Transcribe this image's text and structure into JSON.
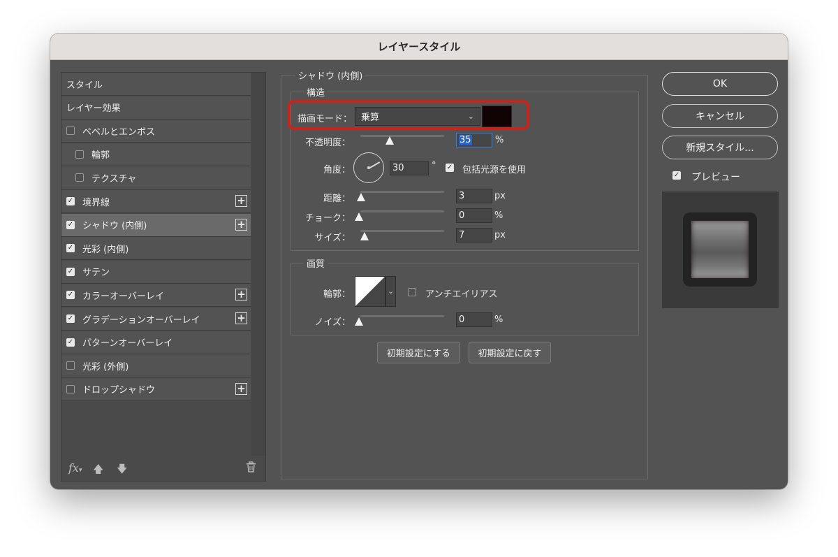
{
  "window": {
    "title": "レイヤースタイル"
  },
  "style_list": {
    "items": [
      {
        "label": "スタイル",
        "checkbox": null,
        "indent": false,
        "plus": false,
        "selected": false
      },
      {
        "label": "レイヤー効果",
        "checkbox": null,
        "indent": false,
        "plus": false,
        "selected": false
      },
      {
        "label": "ベベルとエンボス",
        "checkbox": false,
        "indent": false,
        "plus": false,
        "selected": false
      },
      {
        "label": "輪郭",
        "checkbox": false,
        "indent": true,
        "plus": false,
        "selected": false
      },
      {
        "label": "テクスチャ",
        "checkbox": false,
        "indent": true,
        "plus": false,
        "selected": false
      },
      {
        "label": "境界線",
        "checkbox": true,
        "indent": false,
        "plus": true,
        "selected": false
      },
      {
        "label": "シャドウ (内側)",
        "checkbox": true,
        "indent": false,
        "plus": true,
        "selected": true
      },
      {
        "label": "光彩 (内側)",
        "checkbox": true,
        "indent": false,
        "plus": false,
        "selected": false
      },
      {
        "label": "サテン",
        "checkbox": true,
        "indent": false,
        "plus": false,
        "selected": false
      },
      {
        "label": "カラーオーバーレイ",
        "checkbox": true,
        "indent": false,
        "plus": true,
        "selected": false
      },
      {
        "label": "グラデーションオーバーレイ",
        "checkbox": true,
        "indent": false,
        "plus": true,
        "selected": false
      },
      {
        "label": "パターンオーバーレイ",
        "checkbox": true,
        "indent": false,
        "plus": false,
        "selected": false
      },
      {
        "label": "光彩 (外側)",
        "checkbox": false,
        "indent": false,
        "plus": false,
        "selected": false
      },
      {
        "label": "ドロップシャドウ",
        "checkbox": false,
        "indent": false,
        "plus": true,
        "selected": false
      }
    ],
    "footer": {
      "fx_label": "fx"
    }
  },
  "panel": {
    "title": "シャドウ (内側)",
    "structure": {
      "title": "構造",
      "blend_mode_label": "描画モード：",
      "blend_mode_value": "乗算",
      "shadow_color": "#110303",
      "opacity_label": "不透明度：",
      "opacity_value": "35",
      "opacity_fraction": 0.35,
      "opacity_unit": "%",
      "angle_label": "角度：",
      "angle_value": "30",
      "angle_unit": "°",
      "global_light_label": "包括光源を使用",
      "global_light_checked": true,
      "distance_label": "距離：",
      "distance_value": "3",
      "distance_unit": "px",
      "choke_label": "チョーク：",
      "choke_value": "0",
      "choke_unit": "%",
      "size_label": "サイズ：",
      "size_value": "7",
      "size_unit": "px"
    },
    "quality": {
      "title": "画質",
      "contour_label": "輪郭：",
      "antialias_label": "アンチエイリアス",
      "antialias_checked": false,
      "noise_label": "ノイズ：",
      "noise_value": "0",
      "noise_unit": "%"
    },
    "make_default_label": "初期設定にする",
    "reset_default_label": "初期設定に戻す"
  },
  "actions": {
    "ok_label": "OK",
    "cancel_label": "キャンセル",
    "new_style_label": "新規スタイル...",
    "preview_label": "プレビュー",
    "preview_checked": true
  },
  "colors": {
    "highlight": "#c8241c",
    "dialog_bg": "#535353",
    "titlebar_bg": "#e3dfdc"
  }
}
